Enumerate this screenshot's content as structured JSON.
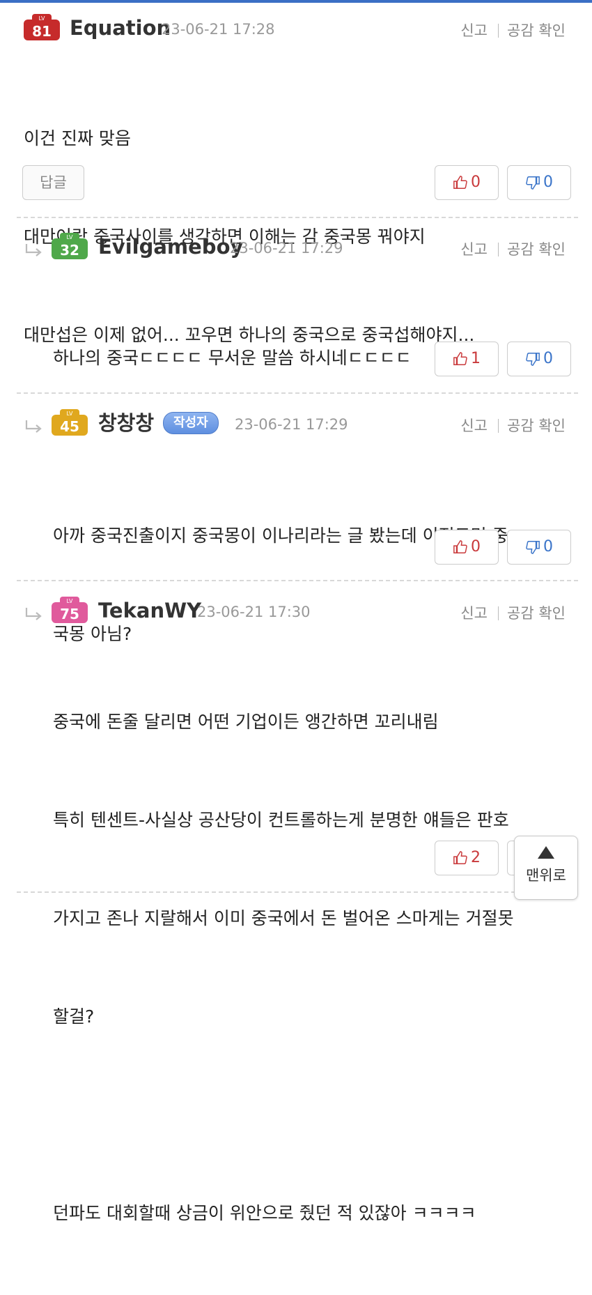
{
  "colors": {
    "accent": "#3b6fc5",
    "up": "#c9393b",
    "down": "#3a74c9"
  },
  "comments": [
    {
      "level": "81",
      "level_color": "#c62b2b",
      "nick": "Equation",
      "date": "23-06-21 17:28",
      "report": "신고",
      "like_check": "공감 확인",
      "lines": [
        "이건 진짜 맞음",
        "대만이랑 중국사이를 생각하면 이해는 감 중국몽 꿔야지",
        "대만섭은 이제 없어... 꼬우면 하나의 중국으로 중국섭해야지..."
      ],
      "reply_label": "답글",
      "up": "0",
      "down": "0"
    },
    {
      "level": "32",
      "level_color": "#4fa84a",
      "nick": "Evilgameboy",
      "date": "23-06-21 17:29",
      "report": "신고",
      "like_check": "공감 확인",
      "lines": [
        "하나의 중국ㄷㄷㄷㄷ 무서운 말씀 하시네ㄷㄷㄷㄷ"
      ],
      "up": "1",
      "down": "0"
    },
    {
      "level": "45",
      "level_color": "#e0a81e",
      "nick": "창창창",
      "badge": "작성자",
      "date": "23-06-21 17:29",
      "report": "신고",
      "like_check": "공감 확인",
      "lines": [
        "아까 중국진출이지 중국몽이 이나리라는 글 봤는데 이정도면 중",
        "국몽 아님?"
      ],
      "up": "0",
      "down": "0"
    },
    {
      "level": "75",
      "level_color": "#e05a9c",
      "nick": "TekanWY",
      "date": "23-06-21 17:30",
      "report": "신고",
      "like_check": "공감 확인",
      "lines": [
        "중국에 돈줄 달리면 어떤 기업이든 앵간하면 꼬리내림",
        "특히 텐센트-사실상 공산당이 컨트롤하는게 분명한 얘들은 판호",
        "가지고 존나 지랄해서 이미 중국에서 돈 벌어온 스마게는 거절못",
        "할걸?",
        "",
        "던파도 대회할때 상금이 위안으로 줬던 적 있잖아 ㅋㅋㅋㅋ"
      ],
      "up": "2"
    }
  ],
  "lv_text": "LV",
  "scroll_top_label": "맨위로"
}
